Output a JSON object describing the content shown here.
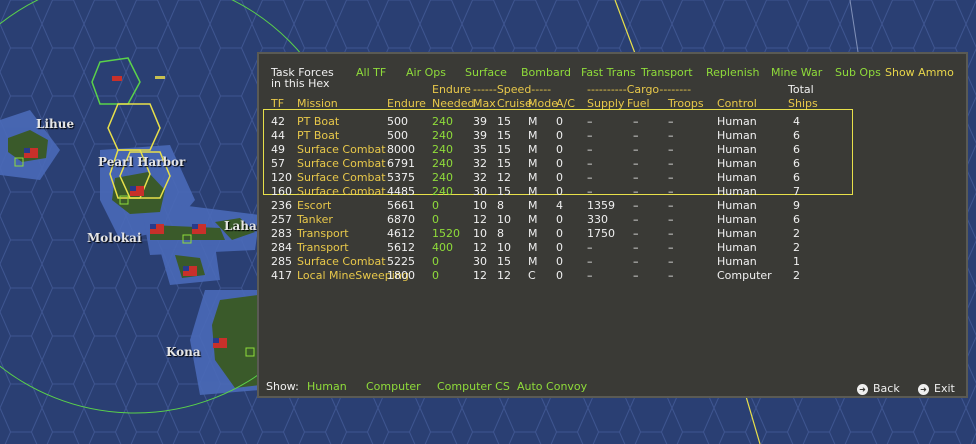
{
  "map": {
    "labels": [
      "Lihue",
      "Pearl Harbor",
      "Molokai",
      "Lahai",
      "Kona"
    ]
  },
  "panel": {
    "title_line1": "Task Forces",
    "title_line2": "in this Hex",
    "tabs": [
      "All TF",
      "Air Ops",
      "Surface",
      "Bombard",
      "Fast Trans",
      "Transport",
      "Replenish",
      "Mine War",
      "Sub Ops"
    ],
    "show_ammo": "Show Ammo",
    "header_top": {
      "endure": "Endure",
      "speed": "------Speed-----",
      "cargo": "----------Cargo--------",
      "total": "Total"
    },
    "columns": [
      "TF",
      "Mission",
      "Endure",
      "Needed",
      "Max",
      "Cruise",
      "Mode",
      "A/C",
      "Supply",
      "Fuel",
      "Troops",
      "Control",
      "Ships"
    ],
    "rows": [
      {
        "tf": "42",
        "mission": "PT Boat",
        "endure": "500",
        "needed": "240",
        "max": "39",
        "cruise": "15",
        "mode": "M",
        "ac": "0",
        "supply": "–",
        "fuel": "–",
        "troops": "–",
        "control": "Human",
        "ships": "4"
      },
      {
        "tf": "44",
        "mission": "PT Boat",
        "endure": "500",
        "needed": "240",
        "max": "39",
        "cruise": "15",
        "mode": "M",
        "ac": "0",
        "supply": "–",
        "fuel": "–",
        "troops": "–",
        "control": "Human",
        "ships": "6"
      },
      {
        "tf": "49",
        "mission": "Surface Combat",
        "endure": "8000",
        "needed": "240",
        "max": "35",
        "cruise": "15",
        "mode": "M",
        "ac": "0",
        "supply": "–",
        "fuel": "–",
        "troops": "–",
        "control": "Human",
        "ships": "6"
      },
      {
        "tf": "57",
        "mission": "Surface Combat",
        "endure": "6791",
        "needed": "240",
        "max": "32",
        "cruise": "15",
        "mode": "M",
        "ac": "0",
        "supply": "–",
        "fuel": "–",
        "troops": "–",
        "control": "Human",
        "ships": "6"
      },
      {
        "tf": "120",
        "mission": "Surface Combat",
        "endure": "5375",
        "needed": "240",
        "max": "32",
        "cruise": "12",
        "mode": "M",
        "ac": "0",
        "supply": "–",
        "fuel": "–",
        "troops": "–",
        "control": "Human",
        "ships": "6"
      },
      {
        "tf": "160",
        "mission": "Surface Combat",
        "endure": "4485",
        "needed": "240",
        "max": "30",
        "cruise": "15",
        "mode": "M",
        "ac": "0",
        "supply": "–",
        "fuel": "–",
        "troops": "–",
        "control": "Human",
        "ships": "7"
      },
      {
        "tf": "236",
        "mission": "Escort",
        "endure": "5661",
        "needed": "0",
        "max": "10",
        "cruise": "8",
        "mode": "M",
        "ac": "4",
        "supply": "1359",
        "fuel": "–",
        "troops": "–",
        "control": "Human",
        "ships": "9"
      },
      {
        "tf": "257",
        "mission": "Tanker",
        "endure": "6870",
        "needed": "0",
        "max": "12",
        "cruise": "10",
        "mode": "M",
        "ac": "0",
        "supply": "330",
        "fuel": "–",
        "troops": "–",
        "control": "Human",
        "ships": "6"
      },
      {
        "tf": "283",
        "mission": "Transport",
        "endure": "4612",
        "needed": "1520",
        "max": "10",
        "cruise": "8",
        "mode": "M",
        "ac": "0",
        "supply": "1750",
        "fuel": "–",
        "troops": "–",
        "control": "Human",
        "ships": "2"
      },
      {
        "tf": "284",
        "mission": "Transport",
        "endure": "5612",
        "needed": "400",
        "max": "12",
        "cruise": "10",
        "mode": "M",
        "ac": "0",
        "supply": "–",
        "fuel": "–",
        "troops": "–",
        "control": "Human",
        "ships": "2"
      },
      {
        "tf": "285",
        "mission": "Surface Combat",
        "endure": "5225",
        "needed": "0",
        "max": "30",
        "cruise": "15",
        "mode": "M",
        "ac": "0",
        "supply": "–",
        "fuel": "–",
        "troops": "–",
        "control": "Human",
        "ships": "1"
      },
      {
        "tf": "417",
        "mission": "Local MineSweeping",
        "endure": "1800",
        "needed": "0",
        "max": "12",
        "cruise": "12",
        "mode": "C",
        "ac": "0",
        "supply": "–",
        "fuel": "–",
        "troops": "–",
        "control": "Computer",
        "ships": "2"
      }
    ],
    "show_label": "Show:",
    "show_options": [
      "Human",
      "Computer",
      "Computer CS",
      "Auto Convoy"
    ],
    "back_label": "Back",
    "exit_label": "Exit"
  },
  "colors": {
    "ocean": "#2a3f73",
    "panel_bg": "#3a3a36",
    "tab_green": "#8fdc3a",
    "header_yellow": "#e8c84a",
    "selection_border": "#e8e04a",
    "hex_highlight": "#e8e04a",
    "range_circle": "#5ad24a"
  }
}
